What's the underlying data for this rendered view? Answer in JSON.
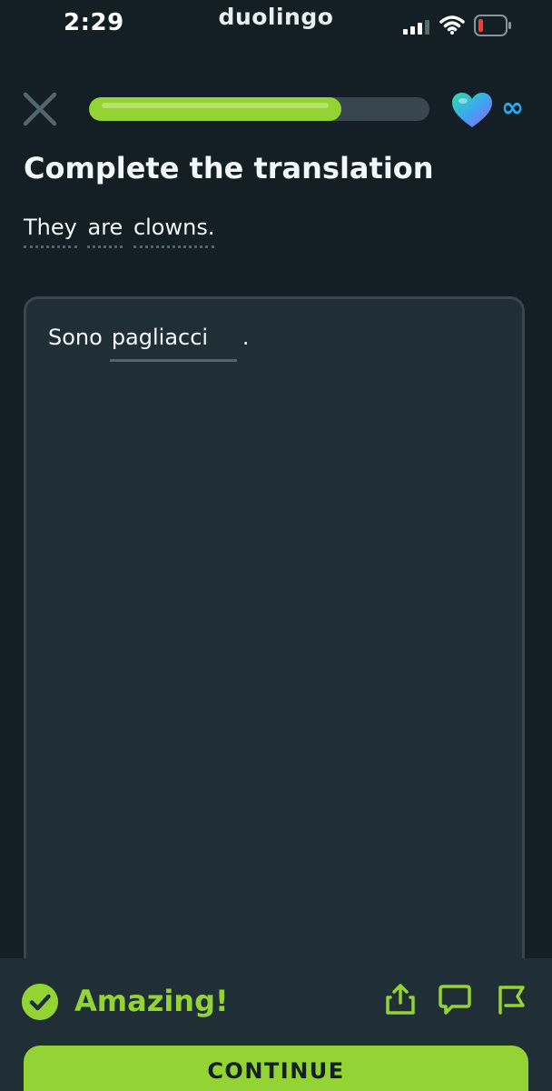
{
  "status_bar": {
    "time": "2:29",
    "carrier": "duolingo",
    "icons": [
      "cellular-signal-icon",
      "wifi-icon",
      "battery-low-icon"
    ]
  },
  "lesson": {
    "progress_fraction": 0.74,
    "hearts": "∞",
    "title": "Complete the translation",
    "prompt_words": [
      "They",
      "are",
      "clowns."
    ]
  },
  "answer": {
    "prefix": "Sono",
    "blank_value": "pagliacci",
    "suffix": "."
  },
  "feedback": {
    "message": "Amazing!",
    "icons": [
      "share-icon",
      "comment-icon",
      "report-flag-icon"
    ],
    "continue_label": "CONTINUE"
  },
  "colors": {
    "background": "#131f24",
    "accent_green": "#93d333",
    "panel": "#202f36",
    "border": "#37464f"
  }
}
